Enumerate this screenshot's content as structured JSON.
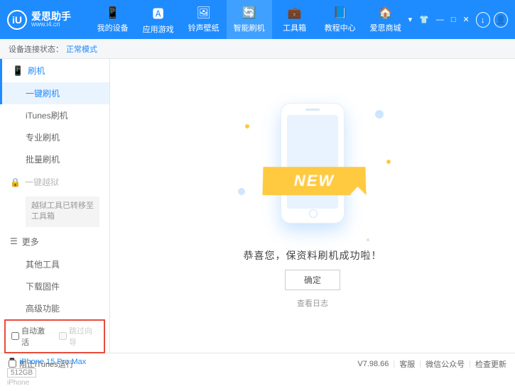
{
  "app": {
    "name": "爱思助手",
    "site": "www.i4.cn",
    "logo_letter": "iU"
  },
  "nav": {
    "items": [
      {
        "label": "我的设备",
        "ico": "📱"
      },
      {
        "label": "应用游戏",
        "ico": "🅰"
      },
      {
        "label": "铃声壁纸",
        "ico": "🖼"
      },
      {
        "label": "智能刷机",
        "ico": "🔄"
      },
      {
        "label": "工具箱",
        "ico": "💼"
      },
      {
        "label": "教程中心",
        "ico": "📘"
      },
      {
        "label": "爱思商城",
        "ico": "🏠"
      }
    ],
    "active_index": 3
  },
  "status": {
    "label": "设备连接状态：",
    "mode": "正常模式"
  },
  "sidebar": {
    "head": {
      "label": "刷机",
      "ico": "📱"
    },
    "flash_items": [
      "一键刷机",
      "iTunes刷机",
      "专业刷机",
      "批量刷机"
    ],
    "flash_active": 0,
    "jailbreak": {
      "label": "一键越狱",
      "note": "越狱工具已转移至工具箱"
    },
    "more": {
      "label": "更多",
      "items": [
        "其他工具",
        "下载固件",
        "高级功能"
      ]
    },
    "checks": {
      "auto_activate": "自动激活",
      "skip_guide": "跳过向导"
    }
  },
  "device": {
    "name": "iPhone 15 Pro Max",
    "capacity": "512GB",
    "platform": "iPhone"
  },
  "main": {
    "ribbon": "NEW",
    "success_text": "恭喜您，保资料刷机成功啦！",
    "ok": "确定",
    "log": "查看日志"
  },
  "footer": {
    "block_itunes": "阻止iTunes运行",
    "version": "V7.98.66",
    "links": [
      "客服",
      "微信公众号",
      "检查更新"
    ]
  }
}
